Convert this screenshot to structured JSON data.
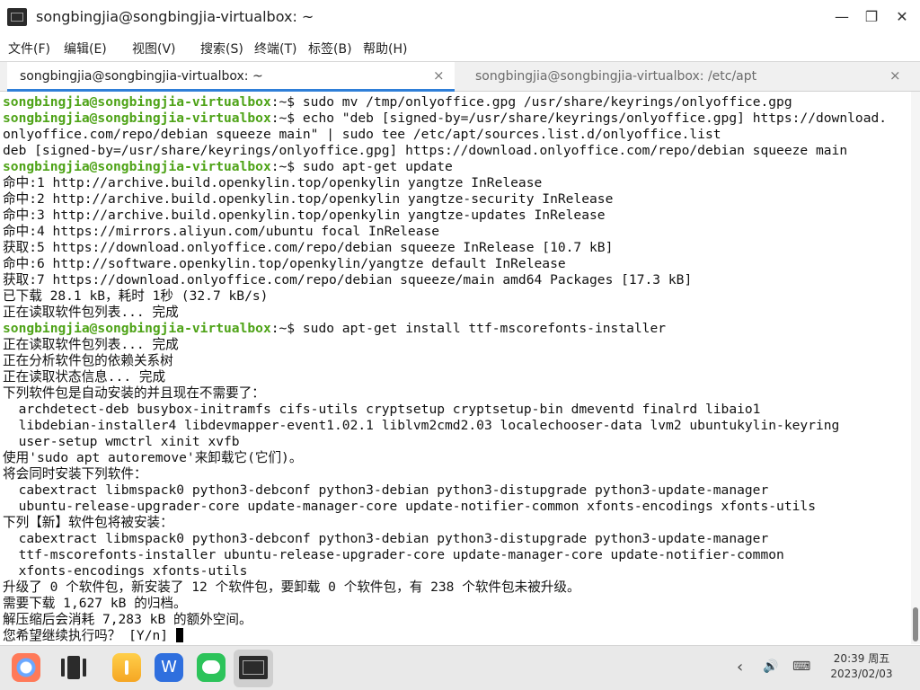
{
  "window": {
    "title": "songbingjia@songbingjia-virtualbox: ~",
    "minimize": "—",
    "restore": "❐",
    "close": "✕"
  },
  "menu": [
    "文件(F)",
    "编辑(E)",
    "视图(V)",
    "搜索(S)",
    "终端(T)",
    "标签(B)",
    "帮助(H)"
  ],
  "tabs": [
    {
      "label": "songbingjia@songbingjia-virtualbox: ~",
      "close": "×",
      "active": true
    },
    {
      "label": "songbingjia@songbingjia-virtualbox: /etc/apt",
      "close": "×",
      "active": false
    }
  ],
  "terminal": {
    "prompt": "songbingjia@songbingjia-virtualbox",
    "lines": [
      {
        "type": "cmd",
        "cmd": "sudo mv /tmp/onlyoffice.gpg /usr/share/keyrings/onlyoffice.gpg"
      },
      {
        "type": "cmd",
        "cmd": "echo \"deb [signed-by=/usr/share/keyrings/onlyoffice.gpg] https://download."
      },
      {
        "type": "out",
        "text": "onlyoffice.com/repo/debian squeeze main\" | sudo tee /etc/apt/sources.list.d/onlyoffice.list"
      },
      {
        "type": "out",
        "text": "deb [signed-by=/usr/share/keyrings/onlyoffice.gpg] https://download.onlyoffice.com/repo/debian squeeze main"
      },
      {
        "type": "cmd",
        "cmd": "sudo apt-get update"
      },
      {
        "type": "out",
        "text": "命中:1 http://archive.build.openkylin.top/openkylin yangtze InRelease"
      },
      {
        "type": "out",
        "text": "命中:2 http://archive.build.openkylin.top/openkylin yangtze-security InRelease"
      },
      {
        "type": "out",
        "text": "命中:3 http://archive.build.openkylin.top/openkylin yangtze-updates InRelease"
      },
      {
        "type": "out",
        "text": "命中:4 https://mirrors.aliyun.com/ubuntu focal InRelease"
      },
      {
        "type": "out",
        "text": "获取:5 https://download.onlyoffice.com/repo/debian squeeze InRelease [10.7 kB]"
      },
      {
        "type": "out",
        "text": "命中:6 http://software.openkylin.top/openkylin/yangtze default InRelease"
      },
      {
        "type": "out",
        "text": "获取:7 https://download.onlyoffice.com/repo/debian squeeze/main amd64 Packages [17.3 kB]"
      },
      {
        "type": "out",
        "text": "已下载 28.1 kB，耗时 1秒 (32.7 kB/s)"
      },
      {
        "type": "out",
        "text": "正在读取软件包列表... 完成"
      },
      {
        "type": "cmd",
        "cmd": "sudo apt-get install ttf-mscorefonts-installer"
      },
      {
        "type": "out",
        "text": "正在读取软件包列表... 完成"
      },
      {
        "type": "out",
        "text": "正在分析软件包的依赖关系树"
      },
      {
        "type": "out",
        "text": "正在读取状态信息... 完成"
      },
      {
        "type": "out",
        "text": "下列软件包是自动安装的并且现在不需要了："
      },
      {
        "type": "out",
        "text": "  archdetect-deb busybox-initramfs cifs-utils cryptsetup cryptsetup-bin dmeventd finalrd libaio1"
      },
      {
        "type": "out",
        "text": "  libdebian-installer4 libdevmapper-event1.02.1 liblvm2cmd2.03 localechooser-data lvm2 ubuntukylin-keyring"
      },
      {
        "type": "out",
        "text": "  user-setup wmctrl xinit xvfb"
      },
      {
        "type": "out",
        "text": "使用'sudo apt autoremove'来卸载它(它们)。"
      },
      {
        "type": "out",
        "text": "将会同时安装下列软件："
      },
      {
        "type": "out",
        "text": "  cabextract libmspack0 python3-debconf python3-debian python3-distupgrade python3-update-manager"
      },
      {
        "type": "out",
        "text": "  ubuntu-release-upgrader-core update-manager-core update-notifier-common xfonts-encodings xfonts-utils"
      },
      {
        "type": "out",
        "text": "下列【新】软件包将被安装："
      },
      {
        "type": "out",
        "text": "  cabextract libmspack0 python3-debconf python3-debian python3-distupgrade python3-update-manager"
      },
      {
        "type": "out",
        "text": "  ttf-mscorefonts-installer ubuntu-release-upgrader-core update-manager-core update-notifier-common"
      },
      {
        "type": "out",
        "text": "  xfonts-encodings xfonts-utils"
      },
      {
        "type": "out",
        "text": "升级了 0 个软件包，新安装了 12 个软件包，要卸载 0 个软件包，有 238 个软件包未被升级。"
      },
      {
        "type": "out",
        "text": "需要下载 1,627 kB 的归档。"
      },
      {
        "type": "out",
        "text": "解压缩后会消耗 7,283 kB 的额外空间。"
      },
      {
        "type": "input",
        "text": "您希望继续执行吗？ [Y/n] "
      }
    ]
  },
  "taskbar": {
    "icons": [
      "browser-icon",
      "multitask-icon",
      "file-manager-icon",
      "wps-icon",
      "wechat-icon",
      "terminal-icon"
    ],
    "tray": {
      "back": "‹",
      "volume": "🔊",
      "keyboard": "⌨"
    },
    "clock": {
      "time_day": "20:39 周五",
      "date": "2023/02/03"
    }
  }
}
